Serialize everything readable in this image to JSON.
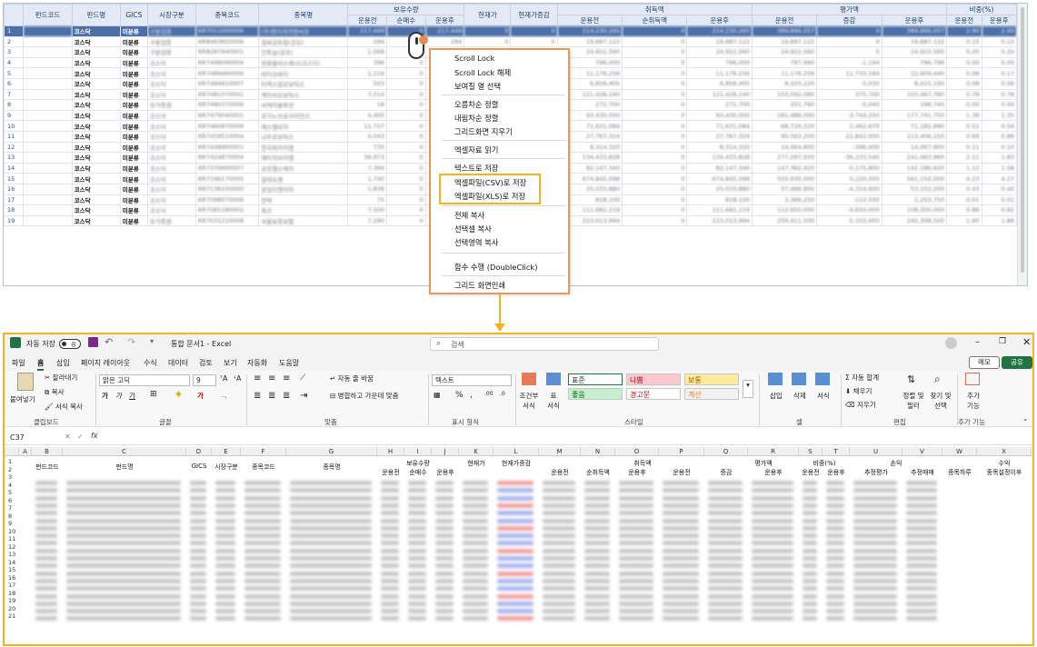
{
  "grid": {
    "headers_top": [
      "펀드코드",
      "펀드명",
      "GICS",
      "시장구분",
      "종목코드",
      "종목명",
      "보유수량",
      "현재가",
      "현재가증감",
      "취득액",
      "평가액",
      "비중(%)"
    ],
    "headers_sub": [
      "운용전",
      "순매수",
      "운용후",
      "운용전",
      "순취득액",
      "운용후",
      "운용전",
      "증감",
      "운용후",
      "운용전",
      "운용후"
    ],
    "rows": [
      {
        "n": "1",
        "fund": "코스닥",
        "gics": "미분류",
        "mkt": "구분검증",
        "code": "KR7011000006",
        "name": "(주)청지차미엔씨유",
        "q1": "217,449",
        "q2": "0",
        "q3": "217,449",
        "p": "0",
        "pc": "0",
        "a1": "214,230,265",
        "a2": "0",
        "a3": "214,230,265",
        "e1": "389,866,057",
        "e2": "0",
        "e3": "389,866,057",
        "w1": "2.90",
        "w2": "2.90"
      },
      {
        "n": "2",
        "fund": "코스닥",
        "gics": "미분류",
        "mkt": "구분검증",
        "code": "KR8463650006",
        "name": "일바공토림(공모)",
        "q1": "294",
        "q2": "0",
        "q3": "294",
        "p": "0",
        "pc": "0",
        "a1": "19,687,122",
        "a2": "0",
        "a3": "19,687,122",
        "e1": "19,687,122",
        "e2": "0",
        "e3": "19,687,122",
        "w1": "0.15",
        "w2": "0.15"
      },
      {
        "n": "3",
        "fund": "코스닥",
        "gics": "미분류",
        "mkt": "구분검증",
        "code": "KR8287940001",
        "name": "인투눌(공모)",
        "q1": "1,568",
        "q2": "0",
        "q3": "1,568",
        "p": "0",
        "pc": "0",
        "a1": "24,922,560",
        "a2": "0",
        "a3": "24,922,560",
        "e1": "24,922,560",
        "e2": "0",
        "e3": "24,922,560",
        "w1": "0.20",
        "w2": "0.20"
      },
      {
        "n": "4",
        "fund": "코스닥",
        "gics": "미분류",
        "mkt": "코스닥",
        "code": "KR7498090004",
        "name": "한화플러스재시(코스닥)",
        "q1": "396",
        "q2": "0",
        "q3": "396",
        "p": "0",
        "pc": "0",
        "a1": "796,000",
        "a2": "0",
        "a3": "796,000",
        "e1": "797,990",
        "e2": "-1,194",
        "e3": "796,796",
        "w1": "0.00",
        "w2": "0.00"
      },
      {
        "n": "5",
        "fund": "코스닥",
        "gics": "미분류",
        "mkt": "코스닥",
        "code": "KR7489460006",
        "name": "바이오바이",
        "q1": "1,216",
        "q2": "0",
        "q3": "1,216",
        "p": "0",
        "pc": "0",
        "a1": "11,176,256",
        "a2": "0",
        "a3": "11,176,256",
        "e1": "11,176,256",
        "e2": "11,733,184",
        "e3": "22,909,440",
        "w1": "0.08",
        "w2": "0.17"
      },
      {
        "n": "6",
        "fund": "코스닥",
        "gics": "미분류",
        "mkt": "코스닥",
        "code": "KR7484810007",
        "name": "티엑스알로보틱스",
        "q1": "503",
        "q2": "0",
        "q3": "503",
        "p": "0",
        "pc": "0",
        "a1": "6,858,405",
        "a2": "0",
        "a3": "6,858,405",
        "e1": "8,420,220",
        "e2": "-5,030",
        "e3": "8,415,190",
        "w1": "0.08",
        "w2": "0.06"
      },
      {
        "n": "7",
        "fund": "코스닥",
        "gics": "미분류",
        "mkt": "코스닥",
        "code": "KR7481070001",
        "name": "케이씨로보틱스",
        "q1": "7,514",
        "q2": "0",
        "q3": "7,514",
        "p": "0",
        "pc": "0",
        "a1": "121,428,240",
        "a2": "0",
        "a3": "121,428,240",
        "e1": "103,092,080",
        "e2": "375,700",
        "e3": "103,467,780",
        "w1": "0.78",
        "w2": "0.78"
      },
      {
        "n": "8",
        "fund": "코스닥",
        "gics": "미분류",
        "mkt": "유가증권",
        "code": "KR7480370006",
        "name": "씨케이솔루션",
        "q1": "18",
        "q2": "0",
        "q3": "18",
        "p": "0",
        "pc": "0",
        "a1": "272,700",
        "a2": "0",
        "a3": "272,700",
        "e1": "201,780",
        "e2": "-5,040",
        "e3": "196,740",
        "w1": "0.00",
        "w2": "0.00"
      },
      {
        "n": "9",
        "fund": "코스닥",
        "gics": "미분류",
        "mkt": "코스닥",
        "code": "KR7479040001",
        "name": "로기노쓰로사이언스",
        "q1": "4,405",
        "q2": "0",
        "q3": "4,405",
        "p": "0",
        "pc": "0",
        "a1": "93,430,050",
        "a2": "0",
        "a3": "93,430,050",
        "e1": "181,486,000",
        "e2": "-3,744,250",
        "e3": "177,741,750",
        "w1": "1.38",
        "w2": "1.35"
      },
      {
        "n": "10",
        "fund": "코스닥",
        "gics": "미분류",
        "mkt": "코스닥",
        "code": "KR7460870009",
        "name": "에스엘비치",
        "q1": "11,727",
        "q2": "0",
        "q3": "11,727",
        "p": "0",
        "pc": "0",
        "a1": "71,631,084",
        "a2": "0",
        "a3": "71,631,084",
        "e1": "68,720,220",
        "e2": "2,462,670",
        "e3": "71,182,890",
        "w1": "0.52",
        "w2": "0.54"
      },
      {
        "n": "11",
        "fund": "코스닥",
        "gics": "미분류",
        "mkt": "코스닥",
        "code": "KR7459510004",
        "name": "나우로보틱스",
        "q1": "4,043",
        "q2": "0",
        "q3": "4,043",
        "p": "0",
        "pc": "0",
        "a1": "27,767,324",
        "a2": "0",
        "a3": "27,767,324",
        "e1": "90,563,200",
        "e2": "22,842,950",
        "e3": "113,406,150",
        "w1": "0.69",
        "w2": "0.86"
      },
      {
        "n": "12",
        "fund": "코스닥",
        "gics": "미분류",
        "mkt": "코스닥",
        "code": "KR7448900001",
        "name": "한국피아이엠",
        "q1": "735",
        "q2": "0",
        "q3": "735",
        "p": "0",
        "pc": "0",
        "a1": "8,314,320",
        "a2": "0",
        "a3": "8,314,320",
        "e1": "14,464,800",
        "e2": "-396,900",
        "e3": "14,067,900",
        "w1": "0.11",
        "w2": "0.10"
      },
      {
        "n": "13",
        "fund": "코스닥",
        "gics": "미분류",
        "mkt": "코스닥",
        "code": "KR7424870004",
        "name": "에이치브이엠",
        "q1": "36,973",
        "q2": "0",
        "q3": "36,973",
        "p": "0",
        "pc": "0",
        "a1": "134,433,828",
        "a2": "0",
        "a3": "134,433,828",
        "e1": "277,297,500",
        "e2": "-36,233,540",
        "e3": "241,063,960",
        "w1": "2.11",
        "w2": "1.83"
      },
      {
        "n": "14",
        "fund": "코스닥",
        "gics": "미분류",
        "mkt": "코스닥",
        "code": "KR7376900007",
        "name": "로킷헬스케어",
        "q1": "7,394",
        "q2": "0",
        "q3": "7,394",
        "p": "0",
        "pc": "0",
        "a1": "82,147,340",
        "a2": "0",
        "a3": "82,147,340",
        "e1": "147,362,420",
        "e2": "-5,175,800",
        "e3": "142,186,620",
        "w1": "1.12",
        "w2": "1.08"
      },
      {
        "n": "15",
        "fund": "코스닥",
        "gics": "미분류",
        "mkt": "코스닥",
        "code": "KR7196170005",
        "name": "알테오젠",
        "q1": "1,740",
        "q2": "0",
        "q3": "1,740",
        "p": "0",
        "pc": "0",
        "a1": "674,845,098",
        "a2": "0",
        "a3": "674,845,098",
        "e1": "555,930,000",
        "e2": "5,220,000",
        "e3": "561,150,000",
        "w1": "4.23",
        "w2": "4.27"
      },
      {
        "n": "16",
        "fund": "코스닥",
        "gics": "미분류",
        "mkt": "코스닥",
        "code": "KR7136150000",
        "name": "원일티엔아이",
        "q1": "1,836",
        "q2": "0",
        "q3": "1,836",
        "p": "0",
        "pc": "0",
        "a1": "25,033,880",
        "a2": "0",
        "a3": "25,033,880",
        "e1": "57,466,800",
        "e2": "-4,314,600",
        "e3": "53,152,200",
        "w1": "0.43",
        "w2": "0.40"
      },
      {
        "n": "17",
        "fund": "코스닥",
        "gics": "미분류",
        "mkt": "코스닥",
        "code": "KR7098070006",
        "name": "한텍",
        "q1": "75",
        "q2": "0",
        "q3": "75",
        "p": "0",
        "pc": "0",
        "a1": "818,100",
        "a2": "0",
        "a3": "818,100",
        "e1": "2,366,250",
        "e2": "-112,500",
        "e3": "2,253,750",
        "w1": "0.01",
        "w2": "0.01"
      },
      {
        "n": "18",
        "fund": "코스닥",
        "gics": "미분류",
        "mkt": "코스닥",
        "code": "KR7081180002",
        "name": "특코",
        "q1": "7,500",
        "q2": "0",
        "q3": "7,500",
        "p": "0",
        "pc": "0",
        "a1": "111,682,219",
        "a2": "0",
        "a3": "111,682,219",
        "e1": "112,950,000",
        "e2": "-4,650,000",
        "e3": "108,300,000",
        "w1": "0.86",
        "w2": "0.82"
      },
      {
        "n": "19",
        "fund": "코스닥",
        "gics": "미분류",
        "mkt": "유가증권",
        "code": "KR7031210008",
        "name": "서울보증보험",
        "q1": "7,290",
        "q2": "0",
        "q3": "7,290",
        "p": "0",
        "pc": "0",
        "a1": "223,013,994",
        "a2": "0",
        "a3": "223,013,994",
        "e1": "250,411,500",
        "e2": "-5,103,000",
        "e3": "245,308,500",
        "w1": "1.90",
        "w2": "1.86"
      }
    ]
  },
  "context_menu": {
    "items": [
      "Scroll Lock",
      "Scroll Lock 해제",
      "보여질 열 선택",
      "오름차순 정렬",
      "내림차순 정렬",
      "그리드화면 지우기",
      "엑셀자료 읽기",
      "텍스트로 저장",
      "엑셀파일(CSV)로 저장",
      "엑셀파일(XLS)로 저장",
      "전체 복사",
      "선택셀 복사",
      "선택영역 복사",
      "함수 수행 (DoubleClick)",
      "그리드 화면인쇄"
    ]
  },
  "excel": {
    "autosave_label": "자동 저장",
    "autosave_state": "끔",
    "doc_title": "통합 문서1 - Excel",
    "search_placeholder": "검색",
    "tabs": [
      "파일",
      "홈",
      "삽입",
      "페이지 레이아웃",
      "수식",
      "데이터",
      "검토",
      "보기",
      "자동화",
      "도움말"
    ],
    "memo": "메모",
    "share": "공유",
    "clipboard": {
      "paste": "붙여넣기",
      "cut": "잘라내기",
      "copy": "복사",
      "format_painter": "서식 복사",
      "label": "클립보드"
    },
    "font": {
      "name": "맑은 고딕",
      "size": "9",
      "label": "글꼴"
    },
    "align": {
      "wrap": "자동 줄 바꿈",
      "merge": "병합하고 가운데 맞춤",
      "label": "맞춤"
    },
    "number": {
      "format": "텍스트",
      "label": "표시 형식"
    },
    "styles": {
      "cond": "조건부 서식",
      "table": "표 서식",
      "normal": "표준",
      "bad": "나쁨",
      "neutral": "보통",
      "good": "좋음",
      "warn": "경고문",
      "calc": "계산",
      "label": "스타일"
    },
    "cells": {
      "insert": "삽입",
      "delete": "삭제",
      "format": "서식",
      "label": "셀"
    },
    "edit": {
      "autosum": "자동 합계",
      "fill": "채우기",
      "clear": "지우기",
      "sort": "정렬 및 필터",
      "find": "찾기 및 선택",
      "label": "편집"
    },
    "addins": {
      "btn": "추가 기능",
      "label": "추가 기능"
    },
    "name_box": "C37",
    "col_letters": [
      "A",
      "B",
      "C",
      "D",
      "E",
      "F",
      "G",
      "H",
      "I",
      "J",
      "K",
      "L",
      "M",
      "N",
      "O",
      "P",
      "Q",
      "R",
      "S",
      "T",
      "U",
      "V",
      "W",
      "X"
    ],
    "sheet_headers_top": [
      "펀드코드",
      "펀드명",
      "GICS",
      "시장구분",
      "종목코드",
      "종목명",
      "보유수량",
      "현재가",
      "현재가증감",
      "취득액",
      "평가액",
      "비중(%)",
      "손익",
      "수익"
    ],
    "sheet_headers_sub": [
      "운용전",
      "순매수",
      "운용후",
      "운용전",
      "순취득액",
      "운용후",
      "운용전",
      "증감",
      "운용후",
      "운용전",
      "운용후",
      "추정평가",
      "추정매매",
      "종목하루",
      "종목설정이후"
    ],
    "row_numbers": [
      "1",
      "2",
      "3",
      "4",
      "5",
      "6",
      "7",
      "8",
      "9",
      "10",
      "11",
      "12",
      "13",
      "14",
      "15",
      "16",
      "17",
      "18",
      "19",
      "20",
      "21"
    ]
  }
}
